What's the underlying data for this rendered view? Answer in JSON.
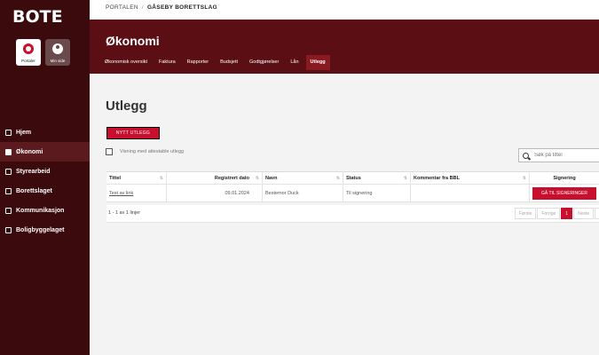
{
  "logo": "BOTE",
  "quick_links": [
    {
      "label": "Portaler",
      "icon": "portal-icon"
    },
    {
      "label": "Min side",
      "icon": "user-icon"
    }
  ],
  "nav": [
    {
      "label": "Hjem",
      "icon": "home-icon",
      "active": false
    },
    {
      "label": "Økonomi",
      "icon": "economy-icon",
      "active": true
    },
    {
      "label": "Styrearbeid",
      "icon": "folder-icon",
      "active": false
    },
    {
      "label": "Borettslaget",
      "icon": "building-icon",
      "active": false
    },
    {
      "label": "Kommunikasjon",
      "icon": "chat-icon",
      "active": false
    },
    {
      "label": "Boligbyggelaget",
      "icon": "house-icon",
      "active": false
    }
  ],
  "breadcrumb": {
    "root": "PORTALEN",
    "separator": "/",
    "current": "GÅSEBY BORETTSLAG"
  },
  "header": {
    "title": "Økonomi"
  },
  "tabs": [
    {
      "label": "Økonomisk oversikt",
      "active": false
    },
    {
      "label": "Faktura",
      "active": false
    },
    {
      "label": "Rapporter",
      "active": false
    },
    {
      "label": "Budsjett",
      "active": false
    },
    {
      "label": "Godtgjørelser",
      "active": false
    },
    {
      "label": "Lån",
      "active": false
    },
    {
      "label": "Utlegg",
      "active": true
    }
  ],
  "main": {
    "title": "Utlegg",
    "new_button": "NYTT UTLEGG",
    "checkbox_label": "Visning med attestable utlegg",
    "search_placeholder": "Søk på tittel"
  },
  "table": {
    "columns": [
      "Tittel",
      "Registrert dato",
      "Navn",
      "Status",
      "Kommentar fra BBL",
      "Signering"
    ],
    "rows": [
      {
        "tittel": "Test av link",
        "dato": "09.01.2024",
        "navn": "Bestemor Duck",
        "status": "Til signering",
        "kommentar": "",
        "action": "GÅ TIL SIGNERINGER"
      }
    ]
  },
  "footer": {
    "count": "1 - 1 av 1 linjer",
    "pager": [
      "Første",
      "Forrige",
      "1",
      "Neste",
      "Si"
    ]
  },
  "colors": {
    "sidebar": "#3a0a0d",
    "header": "#5b0f15",
    "accent": "#c8102e"
  }
}
